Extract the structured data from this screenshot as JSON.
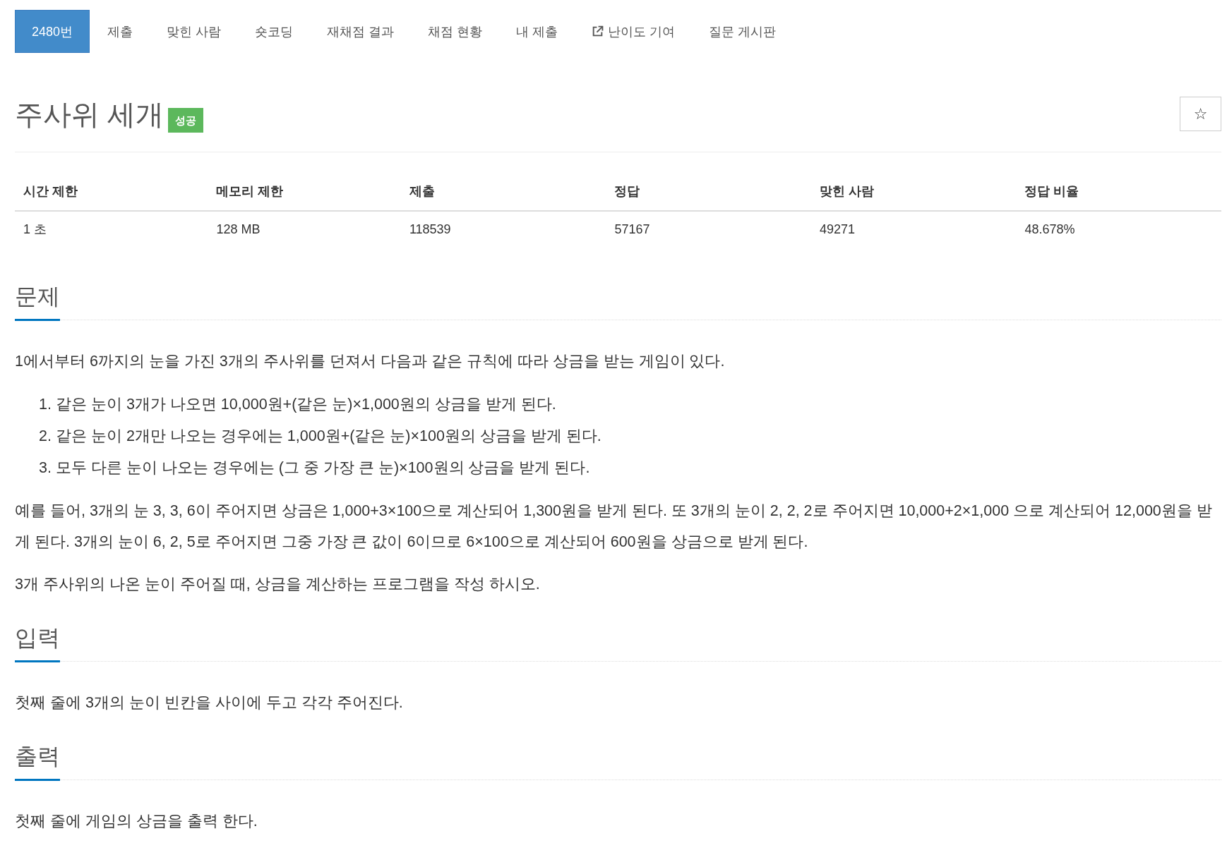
{
  "tabs": [
    {
      "label": "2480번",
      "selected": true,
      "kind": "page"
    },
    {
      "label": "제출",
      "selected": false,
      "kind": "page"
    },
    {
      "label": "맞힌 사람",
      "selected": false,
      "kind": "page"
    },
    {
      "label": "숏코딩",
      "selected": false,
      "kind": "page"
    },
    {
      "label": "재채점 결과",
      "selected": false,
      "kind": "page"
    },
    {
      "label": "채점 현황",
      "selected": false,
      "kind": "page"
    },
    {
      "label": "내 제출",
      "selected": false,
      "kind": "page"
    },
    {
      "label": "난이도 기여",
      "selected": false,
      "kind": "external"
    },
    {
      "label": "질문 게시판",
      "selected": false,
      "kind": "page"
    }
  ],
  "problem": {
    "title": "주사위 세개",
    "result_badge": "성공",
    "star_button": "☆"
  },
  "info_table": {
    "columns": [
      "시간 제한",
      "메모리 제한",
      "제출",
      "정답",
      "맞힌 사람",
      "정답 비율"
    ],
    "rows": [
      [
        "1 초",
        "128 MB",
        "118539",
        "57167",
        "49271",
        "48.678%"
      ]
    ]
  },
  "sections": [
    {
      "heading": "문제",
      "blocks": [
        {
          "kind": "paragraph",
          "text": "1에서부터 6까지의 눈을 가진 3개의 주사위를 던져서 다음과 같은 규칙에 따라 상금을 받는 게임이 있다."
        },
        {
          "kind": "ordered_list",
          "items": [
            {
              "number": "1.",
              "text": "같은 눈이 3개가 나오면 10,000원+(같은 눈)×1,000원의 상금을 받게 된다."
            },
            {
              "number": "2.",
              "text": "같은 눈이 2개만 나오는 경우에는 1,000원+(같은 눈)×100원의 상금을 받게 된다."
            },
            {
              "number": "3.",
              "text": "모두 다른 눈이 나오는 경우에는 (그 중 가장 큰 눈)×100원의 상금을 받게 된다."
            }
          ]
        },
        {
          "kind": "paragraph",
          "text": "예를 들어, 3개의 눈 3, 3, 6이 주어지면 상금은 1,000+3×100으로 계산되어 1,300원을 받게 된다. 또 3개의 눈이 2, 2, 2로 주어지면 10,000+2×1,000 으로 계산되어 12,000원을 받게 된다. 3개의 눈이 6, 2, 5로 주어지면 그중 가장 큰 값이 6이므로 6×100으로 계산되어 600원을 상금으로 받게 된다."
        },
        {
          "kind": "paragraph",
          "text": "3개 주사위의 나온 눈이 주어질 때, 상금을 계산하는 프로그램을 작성 하시오."
        }
      ]
    },
    {
      "heading": "입력",
      "blocks": [
        {
          "kind": "paragraph",
          "text": "첫째 줄에 3개의 눈이 빈칸을 사이에 두고 각각 주어진다."
        }
      ]
    },
    {
      "heading": "출력",
      "blocks": [
        {
          "kind": "paragraph",
          "text": "첫째 줄에 게임의 상금을 출력 한다."
        }
      ]
    }
  ]
}
